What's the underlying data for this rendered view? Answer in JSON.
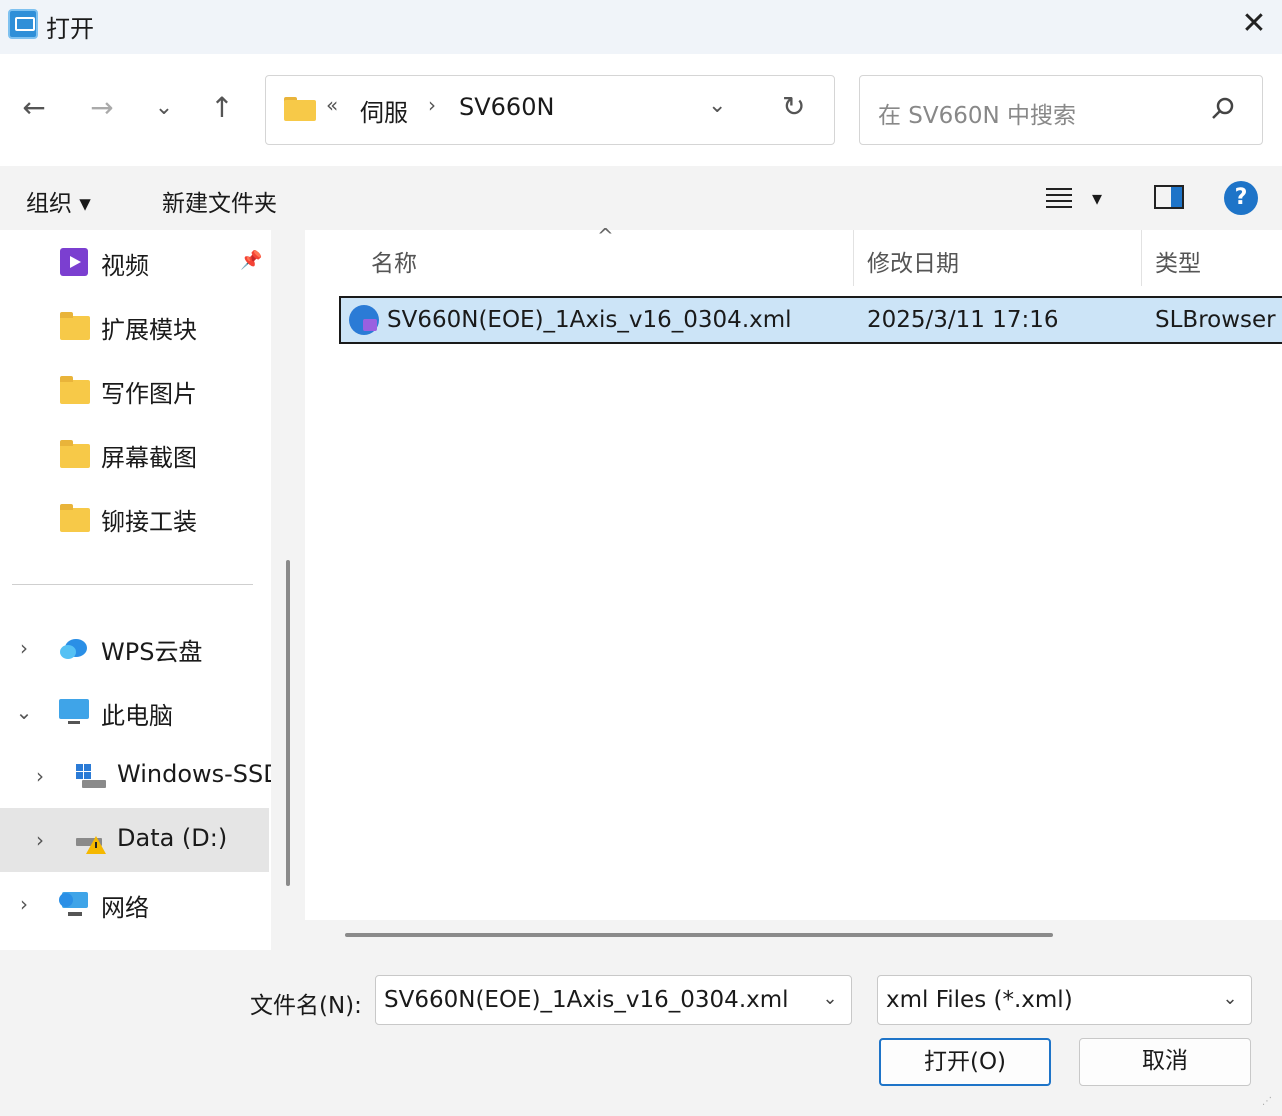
{
  "window": {
    "title": "打开",
    "close_glyph": "✕"
  },
  "nav": {
    "back_glyph": "←",
    "forward_glyph": "→",
    "recent_glyph": "⌄",
    "up_glyph": "↑"
  },
  "address": {
    "overflow_glyph": "«",
    "crumbs": [
      "伺服",
      "SV660N"
    ],
    "separator": "›",
    "dropdown_glyph": "⌄",
    "refresh_glyph": "↻"
  },
  "search": {
    "placeholder": "在 SV660N 中搜索"
  },
  "toolbar": {
    "organize_label": "组织 ▾",
    "new_folder_label": "新建文件夹",
    "view_dropdown_glyph": "▾",
    "help_glyph": "?"
  },
  "sidebar": {
    "items": [
      {
        "label": "视频",
        "icon": "video-icon",
        "pinned": true
      },
      {
        "label": "扩展模块",
        "icon": "folder-icon"
      },
      {
        "label": "写作图片",
        "icon": "folder-icon"
      },
      {
        "label": "屏幕截图",
        "icon": "folder-icon"
      },
      {
        "label": "铆接工装",
        "icon": "folder-icon"
      },
      {
        "label": "WPS云盘",
        "icon": "cloud-icon",
        "chevron": "›"
      },
      {
        "label": "此电脑",
        "icon": "computer-icon",
        "chevron": "⌄"
      },
      {
        "label": "Windows-SSD",
        "icon": "windows-drive-icon",
        "chevron": "›"
      },
      {
        "label": "Data (D:)",
        "icon": "drive-warning-icon",
        "chevron": "›",
        "selected": true
      },
      {
        "label": "网络",
        "icon": "network-icon",
        "chevron": "›"
      }
    ],
    "pin_glyph": "📌"
  },
  "files": {
    "columns": [
      "名称",
      "修改日期",
      "类型"
    ],
    "sort_glyph": "^",
    "rows": [
      {
        "name": "SV660N(EOE)_1Axis_v16_0304.xml",
        "modified": "2025/3/11 17:16",
        "type": "SLBrowser",
        "selected": true
      }
    ]
  },
  "footer": {
    "filename_label": "文件名(N):",
    "filename_value": "SV660N(EOE)_1Axis_v16_0304.xml",
    "filter_value": "xml Files (*.xml)",
    "dropdown_glyph": "⌄",
    "open_label": "打开(O)",
    "cancel_label": "取消"
  },
  "colors": {
    "accent": "#1e74c8",
    "selection": "#cce4f7",
    "folder": "#f7c948"
  }
}
